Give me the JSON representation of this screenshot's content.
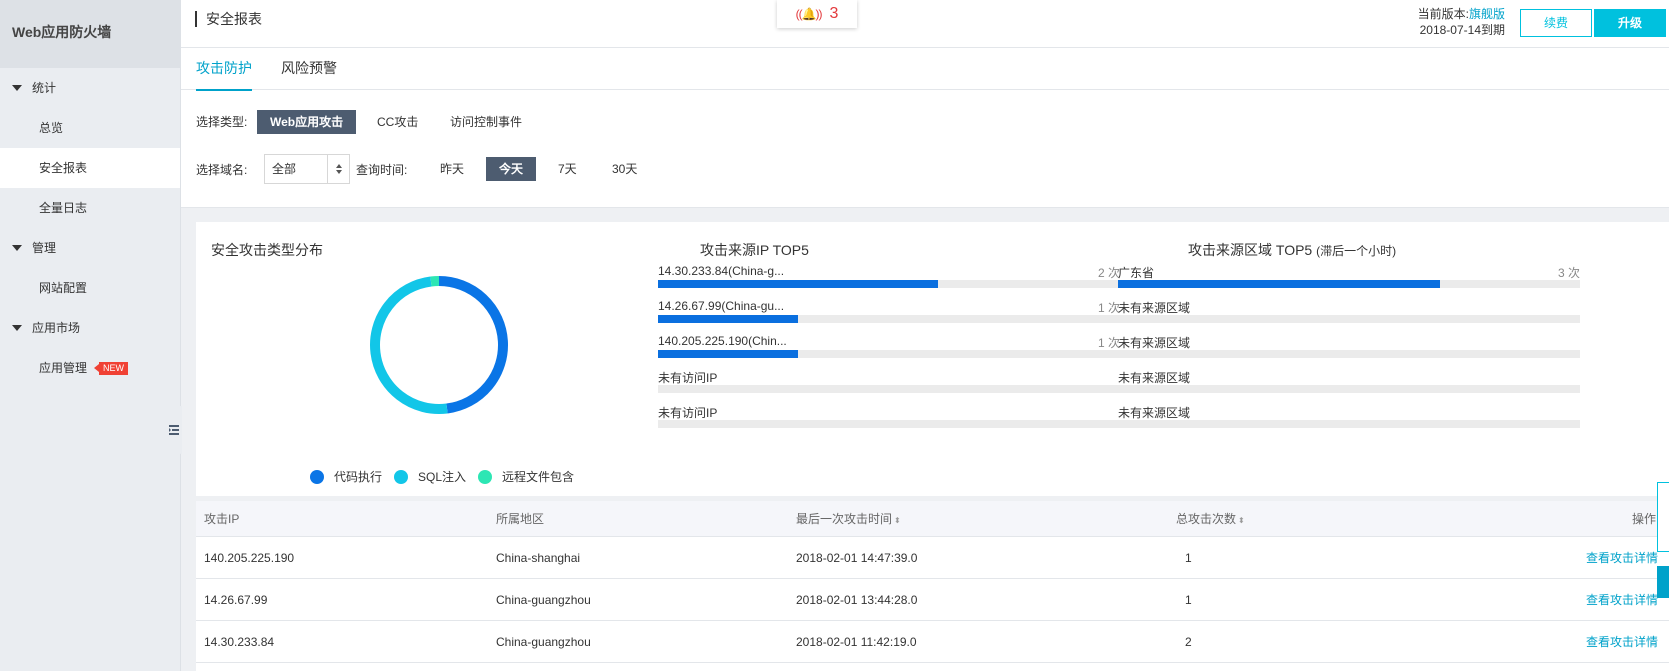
{
  "sidebar": {
    "brand": "Web应用防火墙",
    "groups": [
      {
        "label": "统计",
        "items": [
          "总览",
          "安全报表",
          "全量日志"
        ]
      },
      {
        "label": "管理",
        "items": [
          "网站配置"
        ]
      },
      {
        "label": "应用市场",
        "items": [
          "应用管理"
        ]
      }
    ],
    "active_item": "安全报表",
    "new_badge": "NEW"
  },
  "header": {
    "page_title": "安全报表",
    "alarm_waves": "((🔔))",
    "alarm_count": "3",
    "version_label": "当前版本:",
    "version_name": "旗舰版",
    "expiry": "2018-07-14到期",
    "renew_button": "续费",
    "upgrade_button": "升级"
  },
  "tabs": [
    {
      "label": "攻击防护",
      "active": true
    },
    {
      "label": "风险预警",
      "active": false
    }
  ],
  "filters": {
    "type_label": "选择类型:",
    "types": [
      {
        "label": "Web应用攻击",
        "active": true
      },
      {
        "label": "CC攻击",
        "active": false
      },
      {
        "label": "访问控制事件",
        "active": false
      }
    ],
    "domain_label": "选择域名:",
    "domain_value": "全部",
    "time_label": "查询时间:",
    "times": [
      {
        "label": "昨天",
        "active": false
      },
      {
        "label": "今天",
        "active": true
      },
      {
        "label": "7天",
        "active": false
      },
      {
        "label": "30天",
        "active": false
      }
    ]
  },
  "attack_types": {
    "title": "安全攻击类型分布",
    "legend": [
      {
        "name": "代码执行",
        "color": "#0a75e6"
      },
      {
        "name": "SQL注入",
        "color": "#12c6e8"
      },
      {
        "name": "远程文件包含",
        "color": "#2de6b4"
      }
    ],
    "chart_data": {
      "type": "pie",
      "series": [
        {
          "name": "代码执行",
          "value": 48
        },
        {
          "name": "SQL注入",
          "value": 50
        },
        {
          "name": "远程文件包含",
          "value": 2
        }
      ]
    }
  },
  "top_ip": {
    "title": "攻击来源IP TOP5",
    "rows": [
      {
        "label": "14.30.233.84(China-g...",
        "count": "2 次",
        "value": 2
      },
      {
        "label": "14.26.67.99(China-gu...",
        "count": "1 次",
        "value": 1
      },
      {
        "label": "140.205.225.190(Chin...",
        "count": "1 次",
        "value": 1
      },
      {
        "label": "未有访问IP",
        "count": "",
        "value": 0
      },
      {
        "label": "未有访问IP",
        "count": "",
        "value": 0
      }
    ],
    "max": 3.3
  },
  "top_region": {
    "title": "攻击来源区域 TOP5",
    "subtitle": "(滞后一个小时)",
    "rows": [
      {
        "label": "广东省",
        "count": "3 次",
        "value": 3
      },
      {
        "label": "未有来源区域",
        "count": "",
        "value": 0
      },
      {
        "label": "未有来源区域",
        "count": "",
        "value": 0
      },
      {
        "label": "未有来源区域",
        "count": "",
        "value": 0
      },
      {
        "label": "未有来源区域",
        "count": "",
        "value": 0
      }
    ],
    "max": 4.3
  },
  "table": {
    "headers": [
      "攻击IP",
      "所属地区",
      "最后一次攻击时间",
      "总攻击次数",
      "操作"
    ],
    "sort_icon": "⬍",
    "rows": [
      {
        "ip": "140.205.225.190",
        "region": "China-shanghai",
        "time": "2018-02-01 14:47:39.0",
        "count": "1",
        "action": "查看攻击详情"
      },
      {
        "ip": "14.26.67.99",
        "region": "China-guangzhou",
        "time": "2018-02-01 13:44:28.0",
        "count": "1",
        "action": "查看攻击详情"
      },
      {
        "ip": "14.30.233.84",
        "region": "China-guangzhou",
        "time": "2018-02-01 11:42:19.0",
        "count": "2",
        "action": "查看攻击详情"
      }
    ]
  }
}
